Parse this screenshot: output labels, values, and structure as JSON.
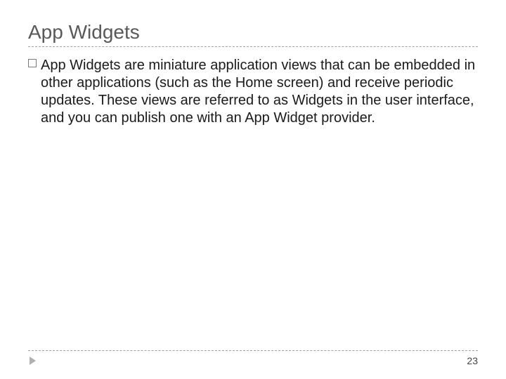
{
  "title": "App Widgets",
  "body": "App Widgets are miniature application views that can be embedded in other applications (such as the Home screen) and receive periodic updates. These views are referred to as Widgets in the user interface, and you can publish one with an App Widget provider.",
  "page_number": "23"
}
